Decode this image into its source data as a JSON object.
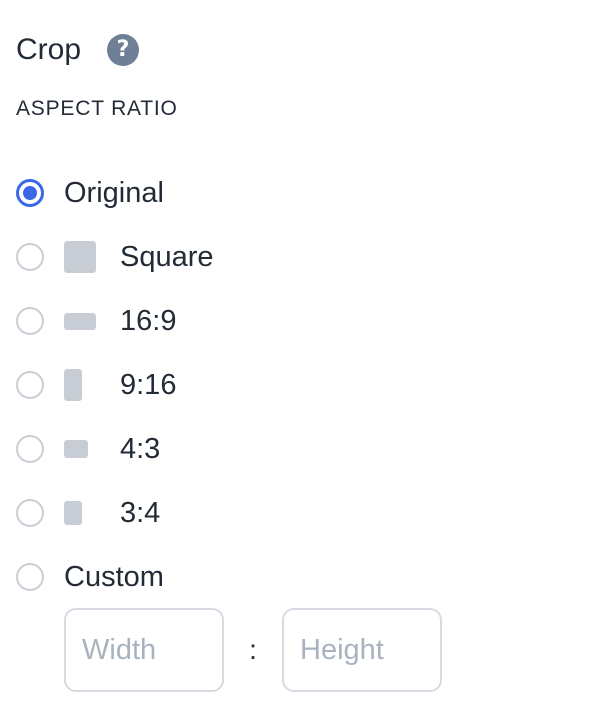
{
  "header": {
    "title": "Crop",
    "help_icon": "question-circle-icon",
    "help_glyph": "?"
  },
  "aspect_ratio": {
    "section_label": "ASPECT RATIO",
    "selected": "Original",
    "options": [
      {
        "label": "Original",
        "checked": true,
        "icon": null
      },
      {
        "label": "Square",
        "checked": false,
        "icon": "square-ratio-icon"
      },
      {
        "label": "16:9",
        "checked": false,
        "icon": "landscape-16-9-icon"
      },
      {
        "label": "9:16",
        "checked": false,
        "icon": "portrait-9-16-icon"
      },
      {
        "label": "4:3",
        "checked": false,
        "icon": "landscape-4-3-icon"
      },
      {
        "label": "3:4",
        "checked": false,
        "icon": "portrait-3-4-icon"
      },
      {
        "label": "Custom",
        "checked": false,
        "icon": null
      }
    ]
  },
  "custom": {
    "width_placeholder": "Width",
    "height_placeholder": "Height",
    "width_value": "",
    "height_value": "",
    "separator": ":"
  },
  "colors": {
    "accent": "#3a68e6",
    "help_icon_bg": "#6e7f96",
    "swatch": "#c7ccd5",
    "text": "#222b36",
    "placeholder": "#a9b2bf"
  }
}
